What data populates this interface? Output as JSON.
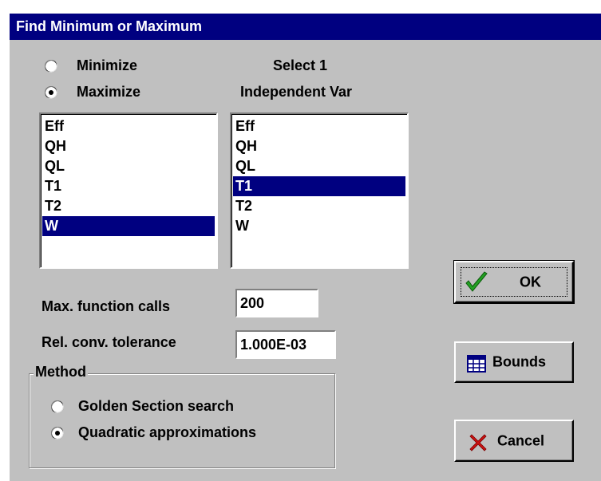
{
  "window": {
    "title": "Find Minimum or Maximum"
  },
  "objective": {
    "options": [
      {
        "label": "Minimize",
        "checked": false
      },
      {
        "label": "Maximize",
        "checked": true
      }
    ]
  },
  "left_list": {
    "items": [
      "Eff",
      "QH",
      "QL",
      "T1",
      "T2",
      "W"
    ],
    "selected": "W"
  },
  "indep_heading": {
    "line1": "Select 1",
    "line2": "Independent Var"
  },
  "right_list": {
    "items": [
      "Eff",
      "QH",
      "QL",
      "T1",
      "T2",
      "W"
    ],
    "selected": "T1"
  },
  "max_calls": {
    "label": "Max. function calls",
    "value": "200"
  },
  "tolerance": {
    "label": "Rel. conv. tolerance",
    "value": "1.000E-03"
  },
  "method": {
    "label": "Method",
    "options": [
      {
        "label": "Golden Section search",
        "checked": false
      },
      {
        "label": "Quadratic approximations",
        "checked": true
      }
    ]
  },
  "buttons": {
    "ok": "OK",
    "bounds": "Bounds",
    "cancel": "Cancel"
  },
  "colors": {
    "title_bg": "#000080",
    "face": "#c0c0c0",
    "selection": "#000080",
    "ok_check": "#22a022",
    "cancel_x": "#cc1111"
  },
  "icons": {
    "ok": "checkmark-icon",
    "bounds": "table-icon",
    "cancel": "x-icon"
  }
}
